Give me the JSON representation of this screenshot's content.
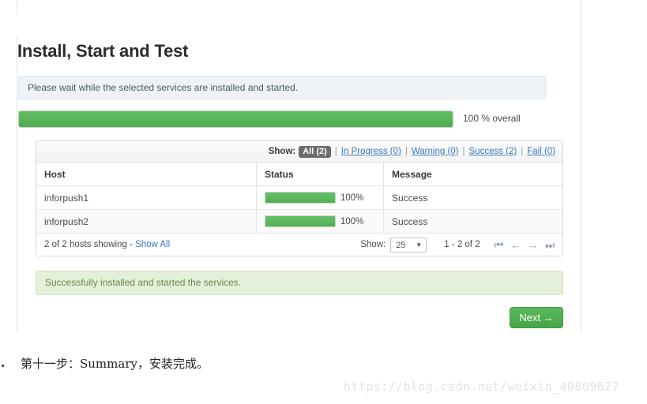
{
  "top_bar": {
    "next_label": "Next →"
  },
  "panel": {
    "title": "Install, Start and Test",
    "info_banner": "Please wait while the selected services are installed and started.",
    "overall": {
      "percent": 100,
      "label": "100 % overall"
    },
    "filter": {
      "show_label": "Show:",
      "options": [
        {
          "label": "All (2)",
          "active": true
        },
        {
          "label": "In Progress (0)",
          "active": false
        },
        {
          "label": "Warning (0)",
          "active": false
        },
        {
          "label": "Success (2)",
          "active": false
        },
        {
          "label": "Fail (0)",
          "active": false
        }
      ],
      "separator": "|"
    },
    "table": {
      "columns": [
        "Host",
        "Status",
        "Message"
      ],
      "rows": [
        {
          "host": "inforpush1",
          "percent": 100,
          "percent_label": "100%",
          "message": "Success"
        },
        {
          "host": "inforpush2",
          "percent": 100,
          "percent_label": "100%",
          "message": "Success"
        }
      ]
    },
    "footer": {
      "hosts_showing": "2 of 2 hosts showing - ",
      "show_all": "Show All",
      "show_label": "Show:",
      "page_size": "25",
      "caret": "▼",
      "range": "1 - 2 of 2",
      "pager": {
        "first": "⏮",
        "prev": "←",
        "next": "→",
        "last": "⏭"
      }
    },
    "success_alert": "Successfully installed and started the services.",
    "next_button": "Next →"
  },
  "caption": "第十一步：Summary，安装完成。",
  "watermark": "https://blog.csdn.net/weixin_40809627",
  "colors": {
    "progress_green": "#5cb85c",
    "link_blue": "#3a7abd",
    "success_text": "#6aa84f",
    "chip_active_bg": "#6b6b6b"
  }
}
